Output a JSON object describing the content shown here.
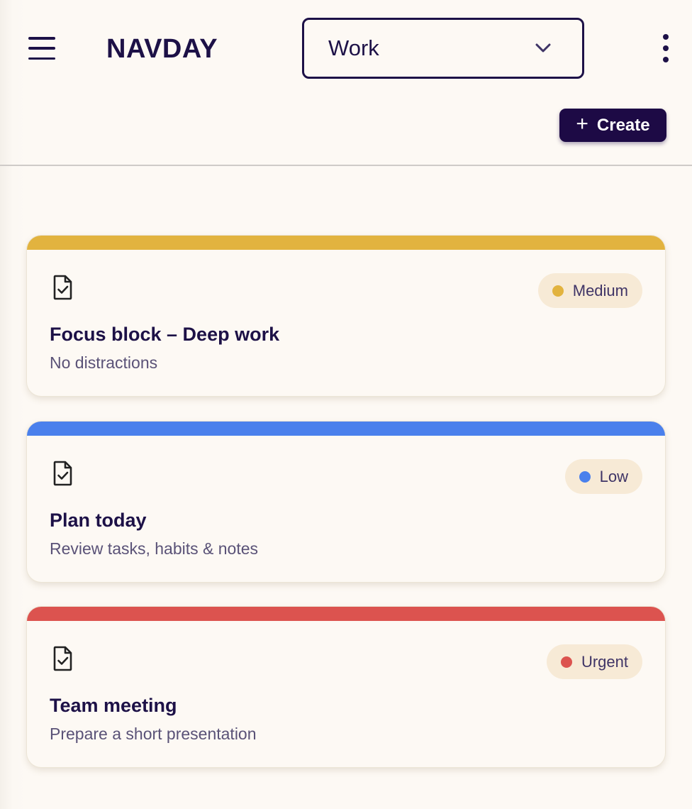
{
  "header": {
    "brand": "NAVDAY",
    "select_value": "Work",
    "create_label": "Create",
    "create_icon": "plus-icon"
  },
  "tasks": [
    {
      "title": "Focus block – Deep work",
      "subtitle": "No distractions",
      "priority": "Medium",
      "color": "#e2b33f",
      "icon": "task-document-check-icon"
    },
    {
      "title": "Plan today",
      "subtitle": "Review tasks, habits & notes",
      "priority": "Low",
      "color": "#4a80ec",
      "icon": "task-document-check-icon"
    },
    {
      "title": "Team meeting",
      "subtitle": "Prepare a short presentation",
      "priority": "Urgent",
      "color": "#dc534f",
      "icon": "task-document-check-icon"
    }
  ]
}
